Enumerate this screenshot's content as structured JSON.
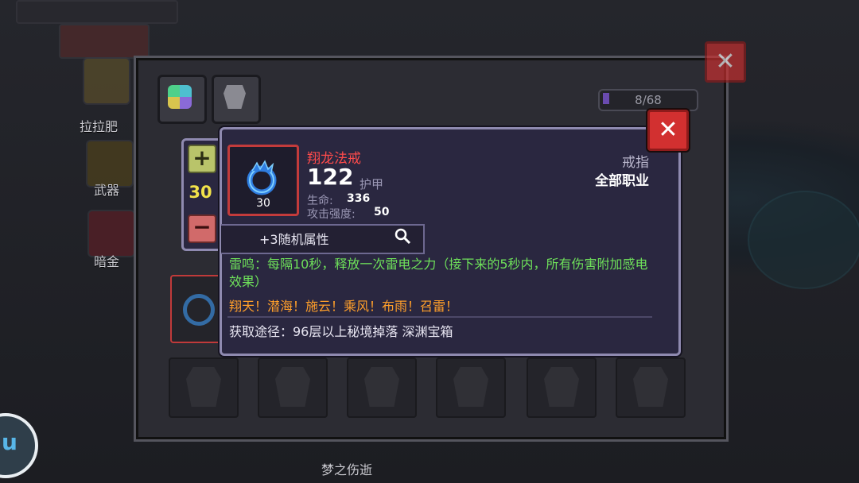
{
  "sidebar": {
    "items": [
      {
        "label": "拉拉肥",
        "icon": "pet-icon"
      },
      {
        "label": "武器",
        "icon": "weapon-icon"
      },
      {
        "label": "暗金",
        "icon": "dark-gold-icon"
      }
    ]
  },
  "inventory": {
    "count": "8/68",
    "tabs": [
      {
        "icon": "gem-grid-icon"
      },
      {
        "icon": "armor-icon"
      }
    ],
    "bottom_name": "梦之伤逝"
  },
  "tooltip": {
    "quantity": "30",
    "item": {
      "name": "翔龙法戒",
      "level": "30",
      "armor_value": "122",
      "armor_label": "护甲",
      "stats": [
        {
          "label": "生命:",
          "value": "336"
        },
        {
          "label": "攻击强度:",
          "value": "50"
        }
      ],
      "type": "戒指",
      "class": "全部职业",
      "random_attr": "+3随机属性",
      "skill": "雷鸣：每隔10秒，释放一次雷电之力（接下来的5秒内，所有伤害附加感电效果）",
      "flavor": "翔天！潜海！施云！乘风！布雨！召雷！",
      "source": "获取途径：96层以上秘境掉落 深渊宝箱"
    }
  },
  "colors": {
    "item_name": "#ff4b4b",
    "skill_text": "#6ee05a",
    "flavor_text": "#ff9f2a",
    "quantity": "#f2e24a",
    "close_button": "#d23030"
  }
}
